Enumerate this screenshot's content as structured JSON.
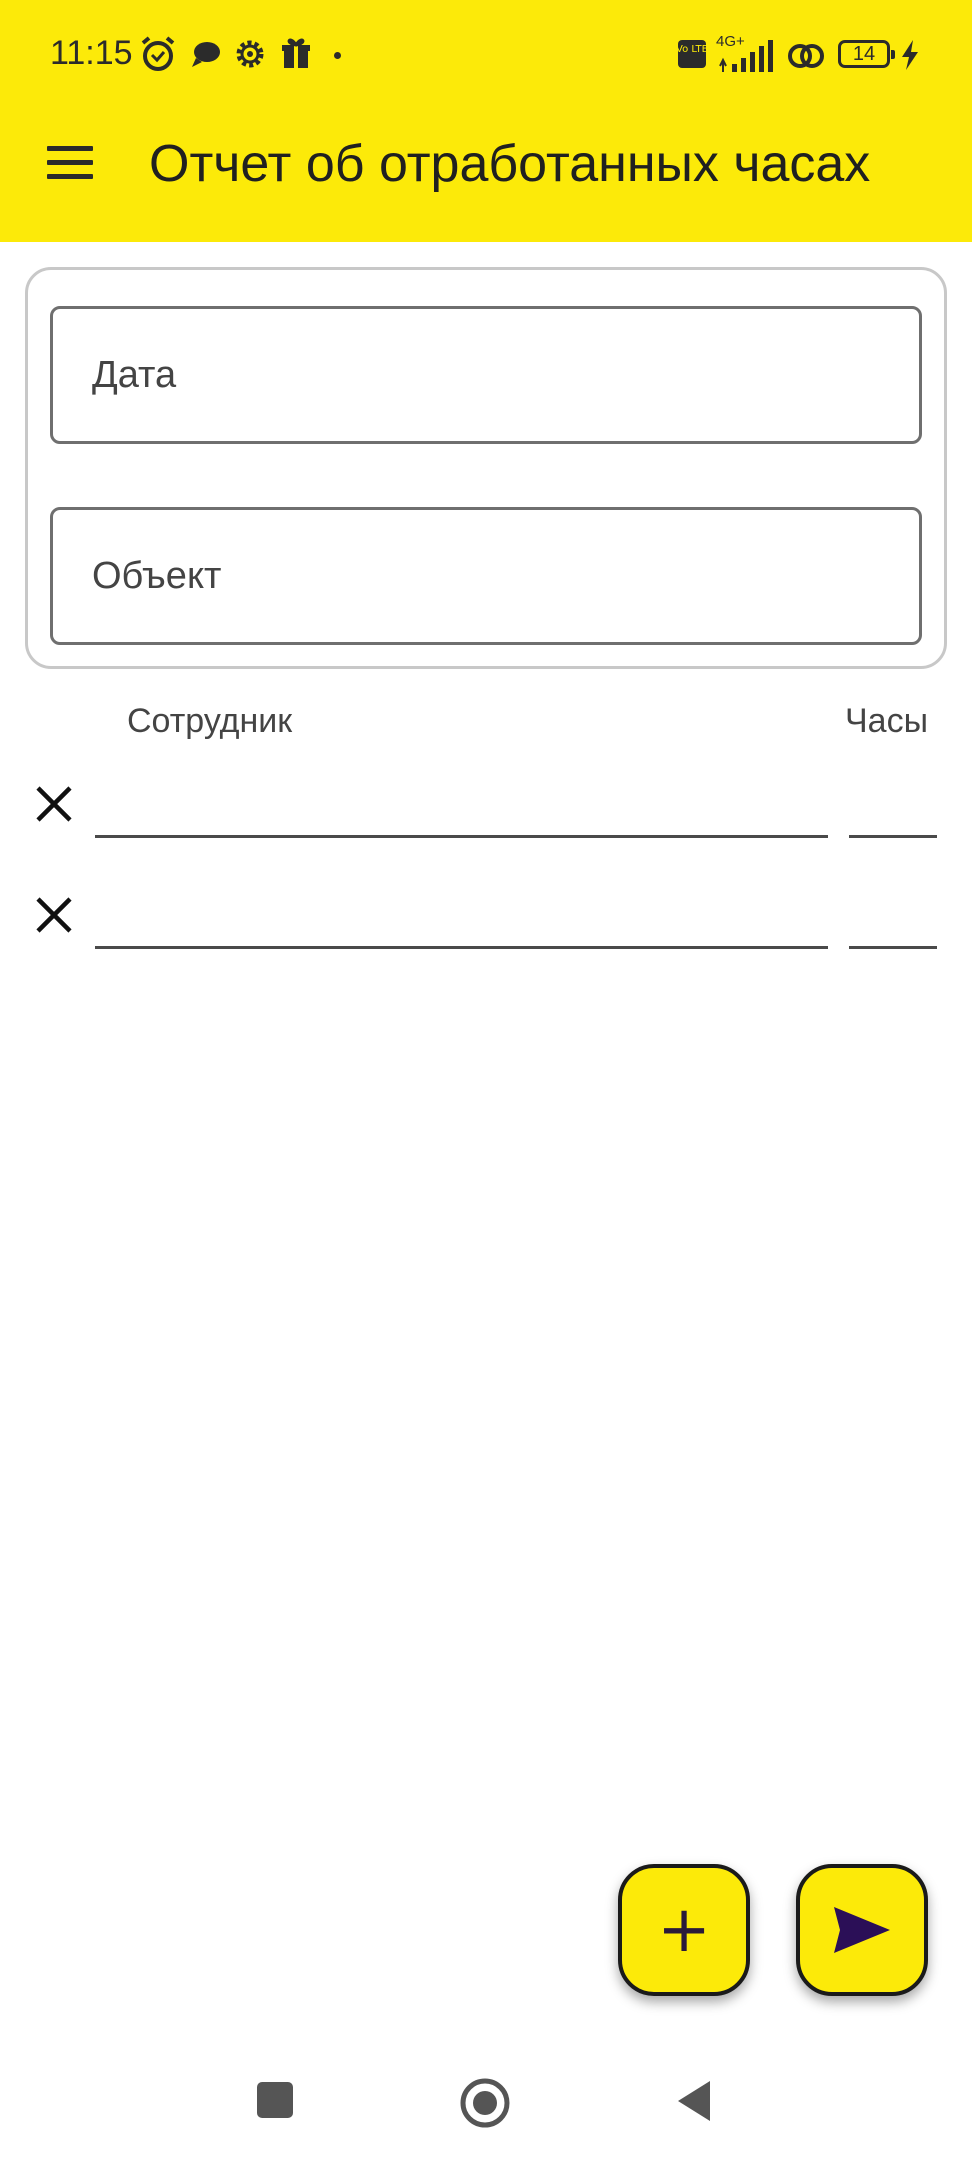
{
  "status_bar": {
    "time": "11:15",
    "network": "4G+",
    "volte": "Vo LTE",
    "battery": "14"
  },
  "app_bar": {
    "title": "Отчет об отработанных часах"
  },
  "form": {
    "date_placeholder": "Дата",
    "object_placeholder": "Объект"
  },
  "table": {
    "employee_header": "Сотрудник",
    "hours_header": "Часы",
    "rows": [
      {
        "employee": "",
        "hours": ""
      },
      {
        "employee": "",
        "hours": ""
      }
    ]
  },
  "fabs": {
    "add_label": "+",
    "send_icon": "send-icon"
  },
  "theme": {
    "accent": "#fcea09",
    "send_icon_color": "#2b0f57"
  }
}
